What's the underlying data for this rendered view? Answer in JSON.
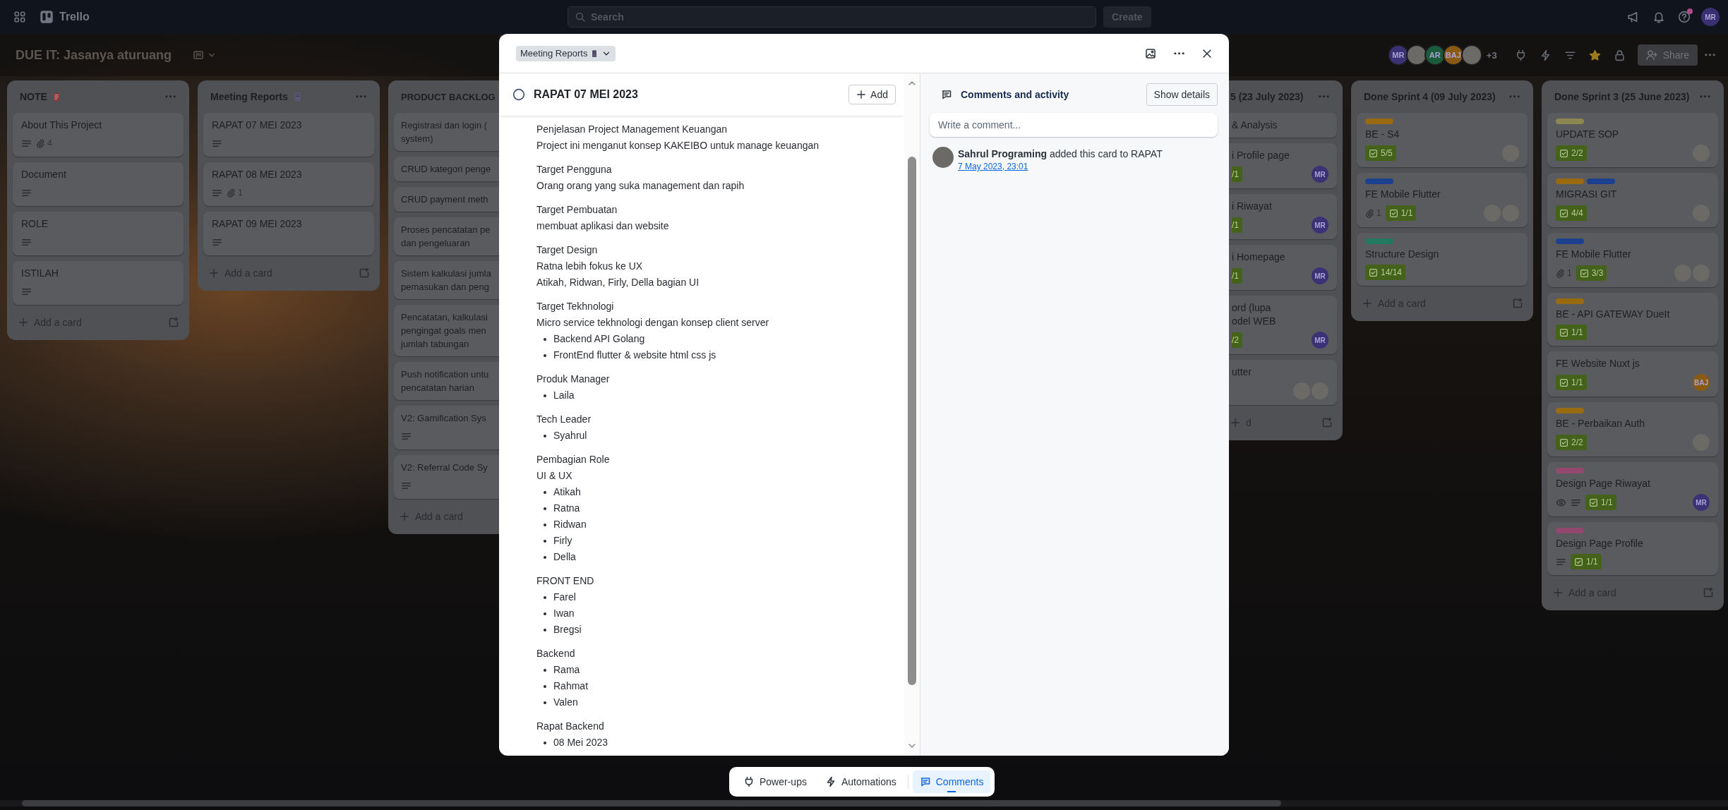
{
  "top_bar": {
    "product": "Trello",
    "search": {
      "placeholder": "Search"
    },
    "create_button": "Create",
    "help_notification": true,
    "avatar": {
      "initials": "MR",
      "color": "#3a2f70"
    }
  },
  "board_header": {
    "title": "DUE IT: Jasanya aturuang",
    "members": [
      {
        "kind": "initials",
        "initials": "MR",
        "color": "#3b3175"
      },
      {
        "kind": "photo"
      },
      {
        "kind": "initials",
        "initials": "AR",
        "color": "#1c5a3c"
      },
      {
        "kind": "initials",
        "initials": "BAJ",
        "color": "#8a5a12"
      },
      {
        "kind": "photo"
      }
    ],
    "more_members": "+3",
    "starred": true,
    "share_button": "Share"
  },
  "lists_left": [
    {
      "title": "NOTE",
      "cards": [
        {
          "title": "About This Project",
          "badges": [
            {
              "kind": "description"
            },
            {
              "kind": "attachment",
              "text": "4"
            }
          ]
        },
        {
          "title": "Document",
          "badges": [
            {
              "kind": "description"
            }
          ]
        },
        {
          "title": "ROLE",
          "badges": [
            {
              "kind": "description"
            }
          ]
        },
        {
          "title": "ISTILAH",
          "badges": [
            {
              "kind": "description"
            }
          ]
        }
      ],
      "add_card": "Add a card"
    },
    {
      "title": "Meeting Reports",
      "cards": [
        {
          "title": "RAPAT 07 MEI 2023",
          "badges": [
            {
              "kind": "description"
            }
          ]
        },
        {
          "title": "RAPAT 08 MEI 2023",
          "badges": [
            {
              "kind": "description"
            },
            {
              "kind": "attachment",
              "text": "1"
            }
          ]
        },
        {
          "title": "RAPAT 09 MEI 2023",
          "badges": [
            {
              "kind": "description"
            }
          ]
        }
      ],
      "add_card": "Add a card"
    },
    {
      "title": "PRODUCT BACKLOG",
      "cards": [
        {
          "lines": [
            "Registrasi dan login (",
            "system)"
          ]
        },
        {
          "lines": [
            "CRUD kategori penge"
          ]
        },
        {
          "lines": [
            "CRUD payment meth"
          ]
        },
        {
          "lines": [
            "Proses pencatatan pe",
            "dan pengeluaran"
          ]
        },
        {
          "lines": [
            "Sistem kalkulasi jumla",
            "pemasukan dan peng"
          ]
        },
        {
          "lines": [
            "Pencatatan, kalkulasi",
            "pengingat goals men",
            "jumlah tabungan"
          ]
        },
        {
          "lines": [
            "Push notification untu",
            "pencatatan harian"
          ]
        },
        {
          "lines": [
            "V2: Gamification Sys"
          ],
          "badges": [
            {
              "kind": "description"
            }
          ]
        },
        {
          "lines": [
            "V2: Referral Code Sy"
          ],
          "badges": [
            {
              "kind": "description"
            }
          ]
        }
      ],
      "add_card": "Add a card"
    }
  ],
  "card_modal": {
    "list_picker": "Meeting Reports",
    "completed": false,
    "title": "RAPAT 07 MEI 2023",
    "add_button": "Add",
    "description": [
      {
        "lines": [
          "Penjelasan Project Management Keuangan",
          "Project ini menganut konsep KAKEIBO untuk manage keuangan"
        ]
      },
      {
        "lines": [
          "Target Pengguna",
          "Orang orang yang suka management dan rapih"
        ]
      },
      {
        "lines": [
          "Target Pembuatan",
          "membuat aplikasi dan website"
        ]
      },
      {
        "lines": [
          "Target Design",
          "Ratna lebih fokus ke UX",
          "Atikah, Ridwan, Firly, Della bagian UI"
        ]
      },
      {
        "lines": [
          "Target Tekhnologi",
          "Micro service tekhnologi dengan konsep client server"
        ],
        "bullets": [
          "Backend API Golang",
          "FrontEnd flutter & website html css js"
        ]
      },
      {
        "lines": [
          "Produk Manager"
        ],
        "bullets": [
          "Laila"
        ]
      },
      {
        "lines": [
          "Tech Leader"
        ],
        "bullets": [
          "Syahrul"
        ]
      },
      {
        "lines": [
          "Pembagian Role",
          "UI & UX"
        ],
        "bullets": [
          "Atikah",
          "Ratna",
          "Ridwan",
          "Firly",
          "Della"
        ]
      },
      {
        "lines": [
          "FRONT END"
        ],
        "bullets": [
          "Farel",
          "Iwan",
          "Bregsi"
        ]
      },
      {
        "lines": [
          "Backend"
        ],
        "bullets": [
          "Rama",
          "Rahmat",
          "Valen"
        ]
      },
      {
        "lines": [
          "Rapat Backend"
        ],
        "bullets": [
          "08 Mei 2023"
        ]
      }
    ],
    "activity": {
      "heading": "Comments and activity",
      "details_button": "Show details",
      "comment": {
        "placeholder": "Write a comment..."
      },
      "entries": [
        {
          "text": "**Sahrul Programing** added this card to RAPAT",
          "time": "7 May 2023, 23:01"
        }
      ]
    }
  },
  "lists_right": [
    {
      "title": "5 (23 July 2023)",
      "cards": [
        {
          "lines": [
            "& Analysis"
          ]
        },
        {
          "lines": [
            "i Profile page"
          ],
          "badges": [
            {
              "kind": "checklist-cut",
              "text": "/1"
            }
          ],
          "members": [
            {
              "kind": "initials",
              "initials": "MR",
              "color": "#3b3175"
            }
          ]
        },
        {
          "lines": [
            "i Riwayat"
          ],
          "badges": [
            {
              "kind": "checklist-cut",
              "text": "/1"
            }
          ],
          "members": [
            {
              "kind": "initials",
              "initials": "MR",
              "color": "#3b3175"
            }
          ]
        },
        {
          "lines": [
            "i Homepage"
          ],
          "badges": [
            {
              "kind": "checklist-cut",
              "text": "/1"
            }
          ],
          "members": [
            {
              "kind": "initials",
              "initials": "MR",
              "color": "#3b3175"
            }
          ]
        },
        {
          "lines": [
            "ord (lupa",
            "odel WEB"
          ],
          "badges": [
            {
              "kind": "checklist-cut",
              "text": "/2"
            }
          ],
          "members": [
            {
              "kind": "initials",
              "initials": "MR",
              "color": "#3b3175"
            }
          ]
        },
        {
          "lines": [
            "utter"
          ],
          "members": [
            {
              "kind": "photo"
            },
            {
              "kind": "photo"
            }
          ]
        }
      ],
      "add_card": "d"
    },
    {
      "title": "Done Sprint 4 (09 July 2023)",
      "cards": [
        {
          "labels": [
            {
              "color": "#9a6a10"
            }
          ],
          "title": "BE - S4",
          "badges": [
            {
              "kind": "checklist",
              "text": "5/5"
            }
          ],
          "members": [
            {
              "kind": "photo"
            }
          ]
        },
        {
          "labels": [
            {
              "color": "#1c3f8e"
            }
          ],
          "title": "FE Mobile Flutter",
          "badges": [
            {
              "kind": "attachment",
              "text": "1"
            },
            {
              "kind": "checklist",
              "text": "1/1"
            }
          ],
          "members": [
            {
              "kind": "photo"
            },
            {
              "kind": "photo"
            }
          ]
        },
        {
          "labels": [
            {
              "color": "#227a5e"
            }
          ],
          "title": "Structure Design",
          "badges": [
            {
              "kind": "checklist",
              "text": "14/14"
            }
          ]
        }
      ],
      "add_card": "Add a card"
    },
    {
      "title": "Done Sprint 3 (25 June 2023)",
      "cards": [
        {
          "labels": [
            {
              "color": "#8c8750"
            }
          ],
          "title": "UPDATE SOP",
          "badges": [
            {
              "kind": "checklist",
              "text": "2/2"
            }
          ],
          "members": [
            {
              "kind": "photo"
            }
          ]
        },
        {
          "labels": [
            {
              "color": "#9a6a10"
            },
            {
              "color": "#1c3f8e"
            }
          ],
          "title": "MIGRASI GIT",
          "badges": [
            {
              "kind": "checklist",
              "text": "4/4"
            }
          ],
          "members": [
            {
              "kind": "photo"
            }
          ]
        },
        {
          "labels": [
            {
              "color": "#1c3f8e"
            }
          ],
          "title": "FE Mobile Flutter",
          "badges": [
            {
              "kind": "attachment",
              "text": "1"
            },
            {
              "kind": "checklist",
              "text": "3/3"
            }
          ],
          "members": [
            {
              "kind": "photo"
            },
            {
              "kind": "photo"
            }
          ]
        },
        {
          "labels": [
            {
              "color": "#9a6a10"
            }
          ],
          "title": "BE - API GATEWAY DueIt",
          "badges": [
            {
              "kind": "checklist",
              "text": "1/1"
            }
          ]
        },
        {
          "title": "FE Website Nuxt js",
          "badges": [
            {
              "kind": "checklist",
              "text": "1/1"
            }
          ],
          "members": [
            {
              "kind": "initials",
              "initials": "BAJ",
              "color": "#8a5a12"
            }
          ]
        },
        {
          "labels": [
            {
              "color": "#9a6a10"
            }
          ],
          "title": "BE - Perbaikan Auth",
          "badges": [
            {
              "kind": "checklist",
              "text": "2/2"
            }
          ],
          "members": [
            {
              "kind": "photo"
            }
          ]
        },
        {
          "labels": [
            {
              "color": "#94476f"
            }
          ],
          "title": "Design Page Riwayat",
          "badges": [
            {
              "kind": "watch"
            },
            {
              "kind": "description"
            },
            {
              "kind": "checklist",
              "text": "1/1"
            }
          ],
          "members": [
            {
              "kind": "initials",
              "initials": "MR",
              "color": "#3b3175"
            }
          ]
        },
        {
          "labels": [
            {
              "color": "#94476f"
            }
          ],
          "title": "Design Page Profile",
          "badges": [
            {
              "kind": "description"
            },
            {
              "kind": "checklist",
              "text": "1/1"
            }
          ]
        }
      ],
      "add_card": "Add a card"
    }
  ],
  "bottom_bar": {
    "buttons": [
      {
        "label": "Power-ups",
        "selected": false
      },
      {
        "label": "Automations",
        "selected": false
      },
      {
        "label": "Comments",
        "selected": true
      }
    ]
  }
}
